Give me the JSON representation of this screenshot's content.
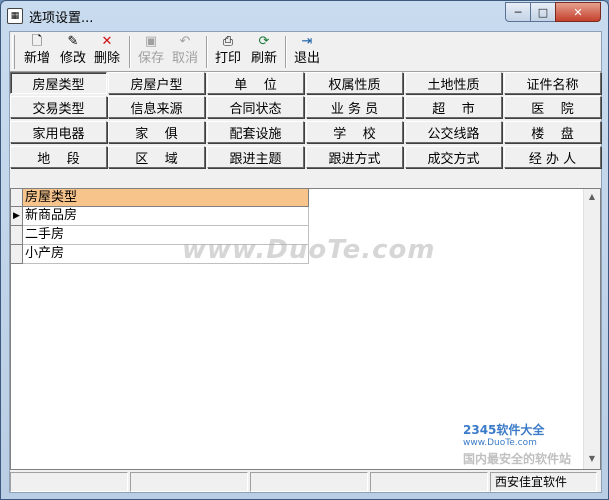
{
  "window": {
    "title": "选项设置...",
    "app_icon": "app-icon",
    "controls": {
      "min": "─",
      "max": "□",
      "close": "✕"
    }
  },
  "toolbar": {
    "buttons": [
      {
        "label": "新增",
        "icon": "new-icon",
        "glyph": "🗋",
        "enabled": true
      },
      {
        "label": "修改",
        "icon": "edit-icon",
        "glyph": "✎",
        "enabled": true
      },
      {
        "label": "删除",
        "icon": "delete-icon",
        "glyph": "✕",
        "enabled": true
      },
      {
        "label": "保存",
        "icon": "save-icon",
        "glyph": "▣",
        "enabled": false
      },
      {
        "label": "取消",
        "icon": "undo-icon",
        "glyph": "↶",
        "enabled": false
      },
      {
        "label": "打印",
        "icon": "print-icon",
        "glyph": "⎙",
        "enabled": true
      },
      {
        "label": "刷新",
        "icon": "refresh-icon",
        "glyph": "⟳",
        "enabled": true
      },
      {
        "label": "退出",
        "icon": "exit-icon",
        "glyph": "⇥",
        "enabled": true
      }
    ]
  },
  "categories": {
    "rows": [
      [
        "房屋类型",
        "房屋户型",
        "单    位",
        "权属性质",
        "土地性质",
        "证件名称"
      ],
      [
        "交易类型",
        "信息来源",
        "合同状态",
        "业 务 员",
        "超    市",
        "医    院"
      ],
      [
        "家用电器",
        "家    俱",
        "配套设施",
        "学    校",
        "公交线路",
        "楼    盘"
      ],
      [
        "地    段",
        "区    域",
        "跟进主题",
        "跟进方式",
        "成交方式",
        "经 办 人"
      ]
    ],
    "active": "房屋类型"
  },
  "grid": {
    "column_header": "房屋类型",
    "rows": [
      "新商品房",
      "二手房",
      "小产房"
    ],
    "current_row_indicator": "▶"
  },
  "status": {
    "panels": [
      "",
      "",
      "",
      "",
      "西安佳宜软件"
    ]
  },
  "watermark": {
    "text": "www.DuoTe.com",
    "corner_logo_line1": "2345软件大全",
    "corner_logo_line2": "www.DuoTe.com",
    "corner_logo_line3": "国内最安全的软件站"
  },
  "colors": {
    "header_bg": "#f7c48c",
    "title_bar": "#c9dbee",
    "close_button": "#c4412d"
  }
}
